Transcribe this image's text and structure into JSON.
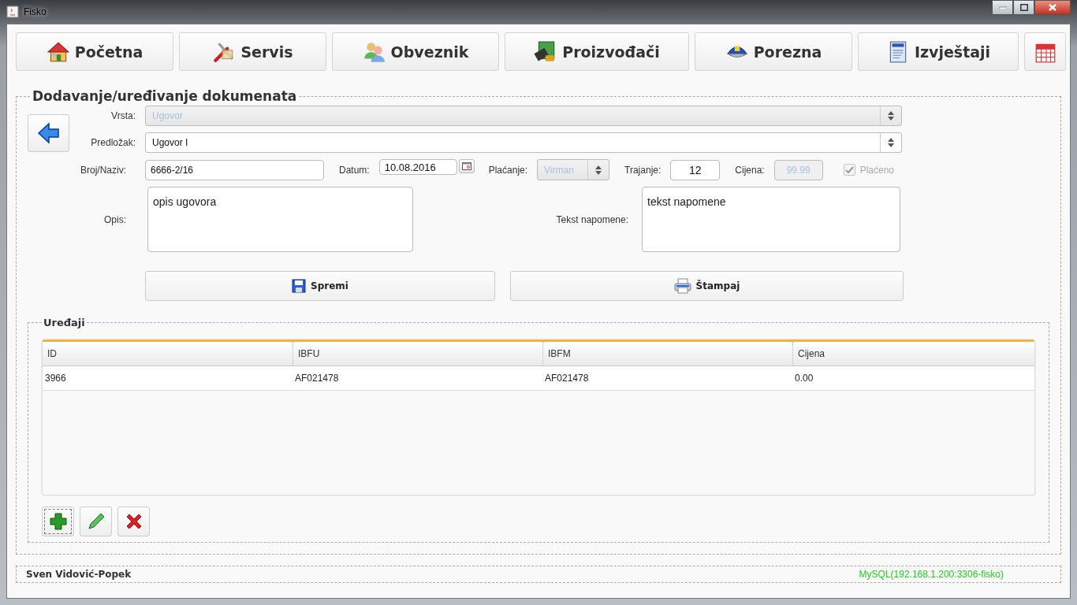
{
  "window": {
    "title": "Fisko"
  },
  "nav": [
    {
      "kind": "house",
      "label": "Početna"
    },
    {
      "kind": "tools",
      "label": "Servis"
    },
    {
      "kind": "people",
      "label": "Obveznik"
    },
    {
      "kind": "chip",
      "label": "Proizvođači"
    },
    {
      "kind": "cap",
      "label": "Porezna"
    },
    {
      "kind": "report",
      "label": "Izvještaji"
    },
    {
      "kind": "calendar"
    }
  ],
  "document": {
    "title": "Dodavanje/uređivanje dokumenata",
    "vrsta": {
      "label": "Vrsta:",
      "value": "Ugovor",
      "disabled": true
    },
    "predlozak": {
      "label": "Predložak:",
      "value": "Ugovor I",
      "disabled": false
    },
    "broj": {
      "label": "Broj/Naziv:",
      "value": "6666-2/16"
    },
    "datum": {
      "label": "Datum:",
      "value": "10.08.2016"
    },
    "placanje": {
      "label": "Plaćanje:",
      "value": "Virman",
      "disabled": true
    },
    "trajanje": {
      "label": "Trajanje:",
      "value": "12"
    },
    "cijena": {
      "label": "Cijena:",
      "value": "99.99",
      "disabled": true
    },
    "placeno": {
      "label": "Plaćeno",
      "checked": true,
      "disabled": true
    },
    "opis": {
      "label": "Opis:",
      "value": "opis ugovora"
    },
    "napomena": {
      "label": "Tekst napomene:",
      "value": "tekst napomene"
    },
    "buttons": [
      {
        "kind": "save",
        "label": "Spremi"
      },
      {
        "kind": "print",
        "label": "Štampaj"
      }
    ]
  },
  "devices": {
    "title": "Uređaji",
    "columns": [
      "ID",
      "IBFU",
      "IBFM",
      "Cijena"
    ],
    "rows": [
      [
        "3966",
        "AF021478",
        "AF021478",
        "0.00"
      ]
    ],
    "actions": [
      {
        "kind": "add",
        "focused": true
      },
      {
        "kind": "edit",
        "focused": false
      },
      {
        "kind": "delete",
        "focused": false
      }
    ]
  },
  "status_bar": {
    "user": "Sven Vidović-Popek",
    "connection": "MySQL(192.168.1.200:3306-fisko)"
  }
}
